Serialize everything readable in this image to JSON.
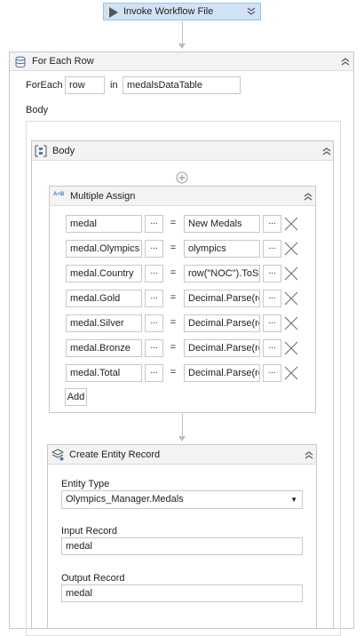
{
  "invoke": {
    "title": "Invoke Workflow File"
  },
  "for_each": {
    "title": "For Each Row",
    "foreach_label": "ForEach",
    "item_var": "row",
    "in_label": "in",
    "collection": "medalsDataTable",
    "body_label": "Body"
  },
  "body_sequence": {
    "title": "Body"
  },
  "multiple_assign": {
    "title": "Multiple Assign",
    "icon_text": "A+B",
    "eq": "=",
    "dots": "...",
    "rows": [
      {
        "left": "medal",
        "right": "New Medals"
      },
      {
        "left": "medal.Olympics",
        "right": "olympics"
      },
      {
        "left": "medal.Country",
        "right": "row(\"NOC\").ToSt"
      },
      {
        "left": "medal.Gold",
        "right": "Decimal.Parse(ro"
      },
      {
        "left": "medal.Silver",
        "right": "Decimal.Parse(ro"
      },
      {
        "left": "medal.Bronze",
        "right": "Decimal.Parse(ro"
      },
      {
        "left": "medal.Total",
        "right": "Decimal.Parse(ro"
      }
    ],
    "add_label": "Add"
  },
  "create_entity": {
    "title": "Create Entity Record",
    "entity_type_label": "Entity Type",
    "entity_type_value": "Olympics_Manager.Medals",
    "input_record_label": "Input Record",
    "input_record_value": "medal",
    "output_record_label": "Output Record",
    "output_record_value": "medal"
  }
}
